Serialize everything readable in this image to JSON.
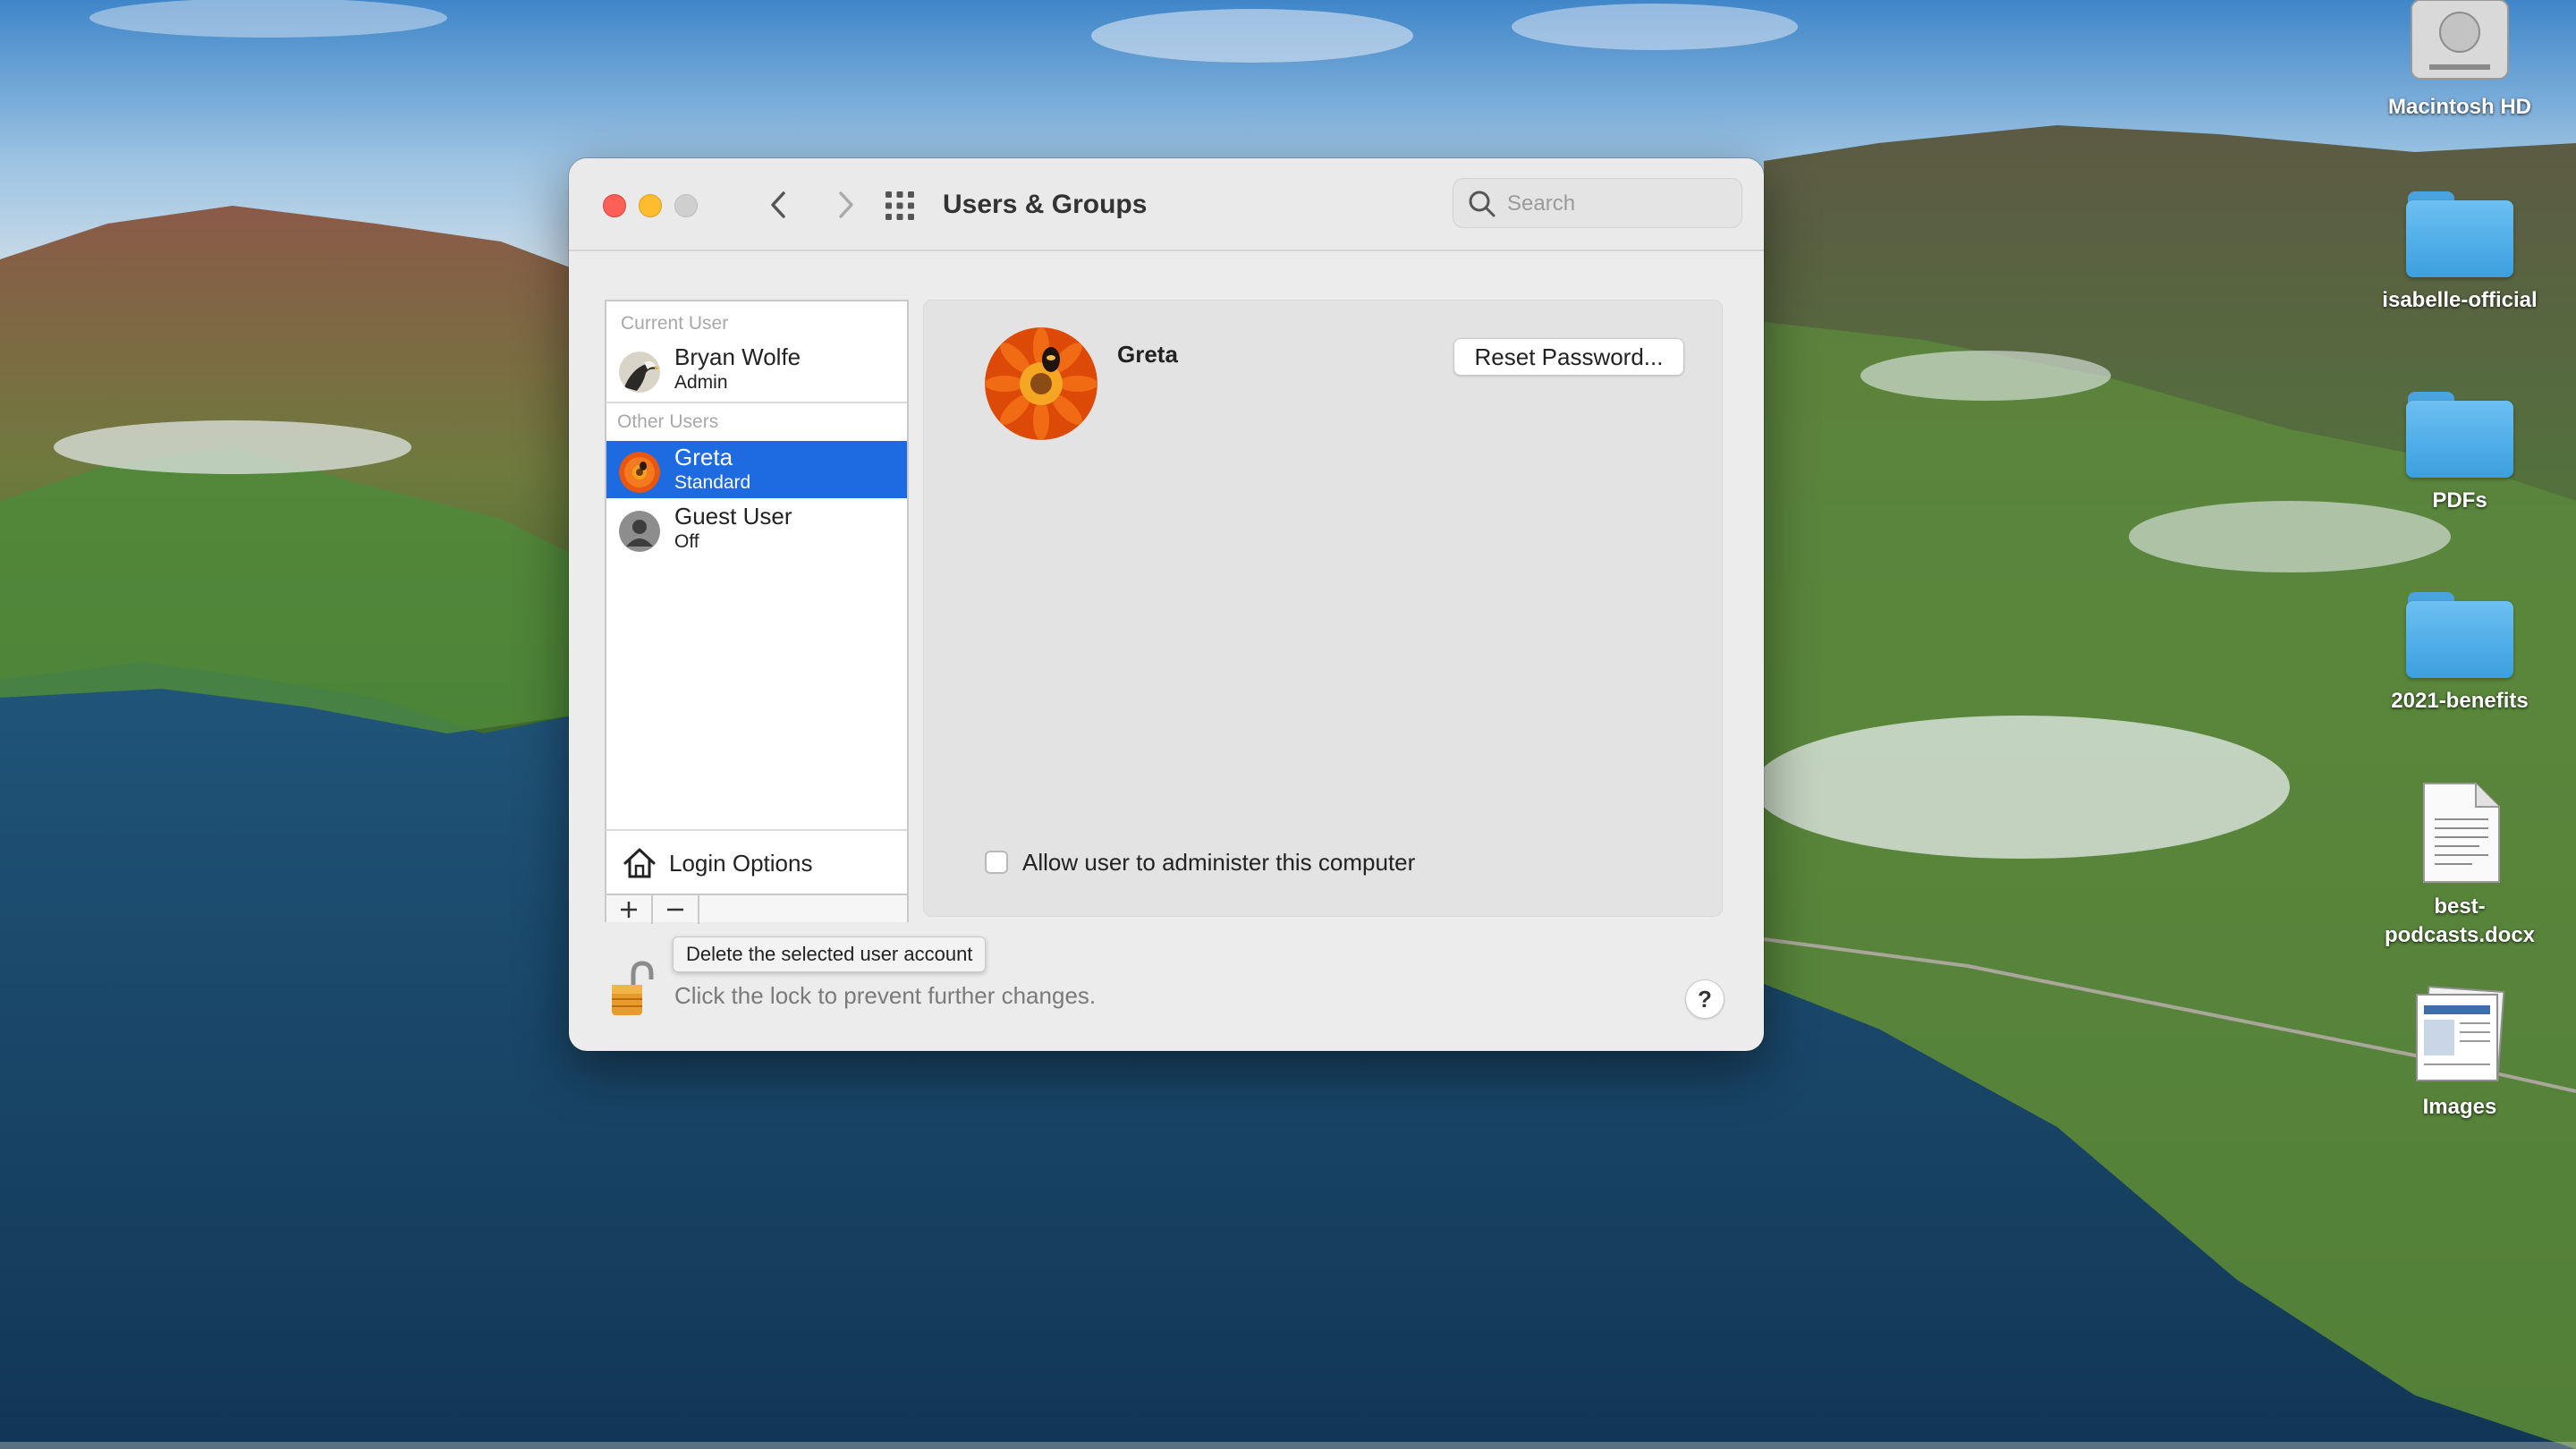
{
  "window": {
    "title": "Users & Groups",
    "search_placeholder": "Search"
  },
  "userlist": {
    "current_user_label": "Current User",
    "other_users_label": "Other Users",
    "users": [
      {
        "name": "Bryan Wolfe",
        "role": "Admin"
      },
      {
        "name": "Greta",
        "role": "Standard",
        "selected": true
      },
      {
        "name": "Guest User",
        "role": "Off"
      }
    ],
    "login_options_label": "Login Options",
    "add_symbol": "+",
    "remove_symbol": "−"
  },
  "detail": {
    "user_name": "Greta",
    "reset_password_label": "Reset Password...",
    "admin_checkbox_label": "Allow user to administer this computer",
    "admin_checked": false
  },
  "tooltip": "Delete the selected user account",
  "lock_text": "Click the lock to prevent further changes.",
  "help_label": "?",
  "desktop_icons": [
    {
      "label": "Macintosh HD",
      "icon": "hard-drive-icon"
    },
    {
      "label": "isabelle-official",
      "icon": "folder-icon"
    },
    {
      "label": "PDFs",
      "icon": "folder-icon"
    },
    {
      "label": "2021-benefits",
      "icon": "folder-icon"
    },
    {
      "label": "best-podcasts.docx",
      "icon": "document-icon"
    },
    {
      "label": "Images",
      "icon": "image-stack-icon"
    }
  ],
  "colors": {
    "selection": "#1e6ae0",
    "close": "#fe5f57",
    "minimize": "#febc2e",
    "folder": "#4aa3df"
  }
}
